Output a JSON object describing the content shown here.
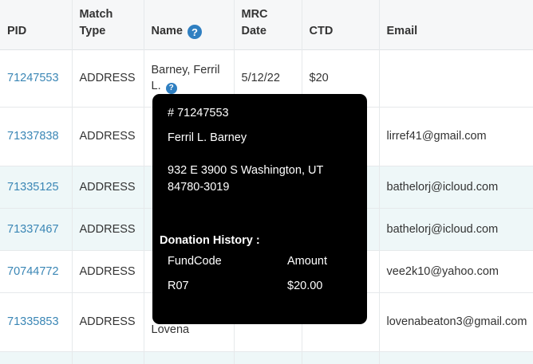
{
  "table": {
    "headers": {
      "pid": "PID",
      "match_type_1": "Match",
      "match_type_2": "Type",
      "name": "Name",
      "mrc_date_1": "MRC",
      "mrc_date_2": "Date",
      "ctd": "CTD",
      "email": "Email"
    },
    "rows": [
      {
        "pid": "71247553",
        "match_type": "ADDRESS",
        "name": "Barney, Ferril L.",
        "name_line1": "Barney, Ferril",
        "name_line2": "L.",
        "mrc_date": "5/12/22",
        "ctd": "$20",
        "email": ""
      },
      {
        "pid": "71337838",
        "match_type": "ADDRESS",
        "name": "",
        "mrc_date": "",
        "ctd": "",
        "email": "lirref41@gmail.com"
      },
      {
        "pid": "71335125",
        "match_type": "ADDRESS",
        "name": "",
        "mrc_date": "",
        "ctd": "",
        "email": "bathelorj@icloud.com"
      },
      {
        "pid": "71337467",
        "match_type": "ADDRESS",
        "name": "",
        "mrc_date": "",
        "ctd": "",
        "email": "bathelorj@icloud.com"
      },
      {
        "pid": "70744772",
        "match_type": "ADDRESS",
        "name": "",
        "mrc_date": "",
        "ctd": "",
        "email": "vee2k10@yahoo.com"
      },
      {
        "pid": "71335853",
        "match_type": "ADDRESS",
        "name_line2": "Lovena",
        "mrc_date": "",
        "ctd": "",
        "email": "lovenabeaton3@gmail.com"
      }
    ]
  },
  "tooltip": {
    "id": "# 71247553",
    "full_name": "Ferril L. Barney",
    "address_line1": "932 E 3900 S Washington, UT",
    "address_line2": "84780-3019",
    "donation_heading": "Donation History :",
    "col_fundcode": "FundCode",
    "col_amount": "Amount",
    "fundcode": "R07",
    "amount": "$20.00"
  },
  "colors": {
    "link": "#3a86b5",
    "help_icon": "#2f7fc1",
    "header_bg": "#f6f7f8",
    "striped_row_bg": "#eef7f8",
    "tooltip_bg": "#000000"
  },
  "icons": {
    "help": "question-circle-icon"
  }
}
